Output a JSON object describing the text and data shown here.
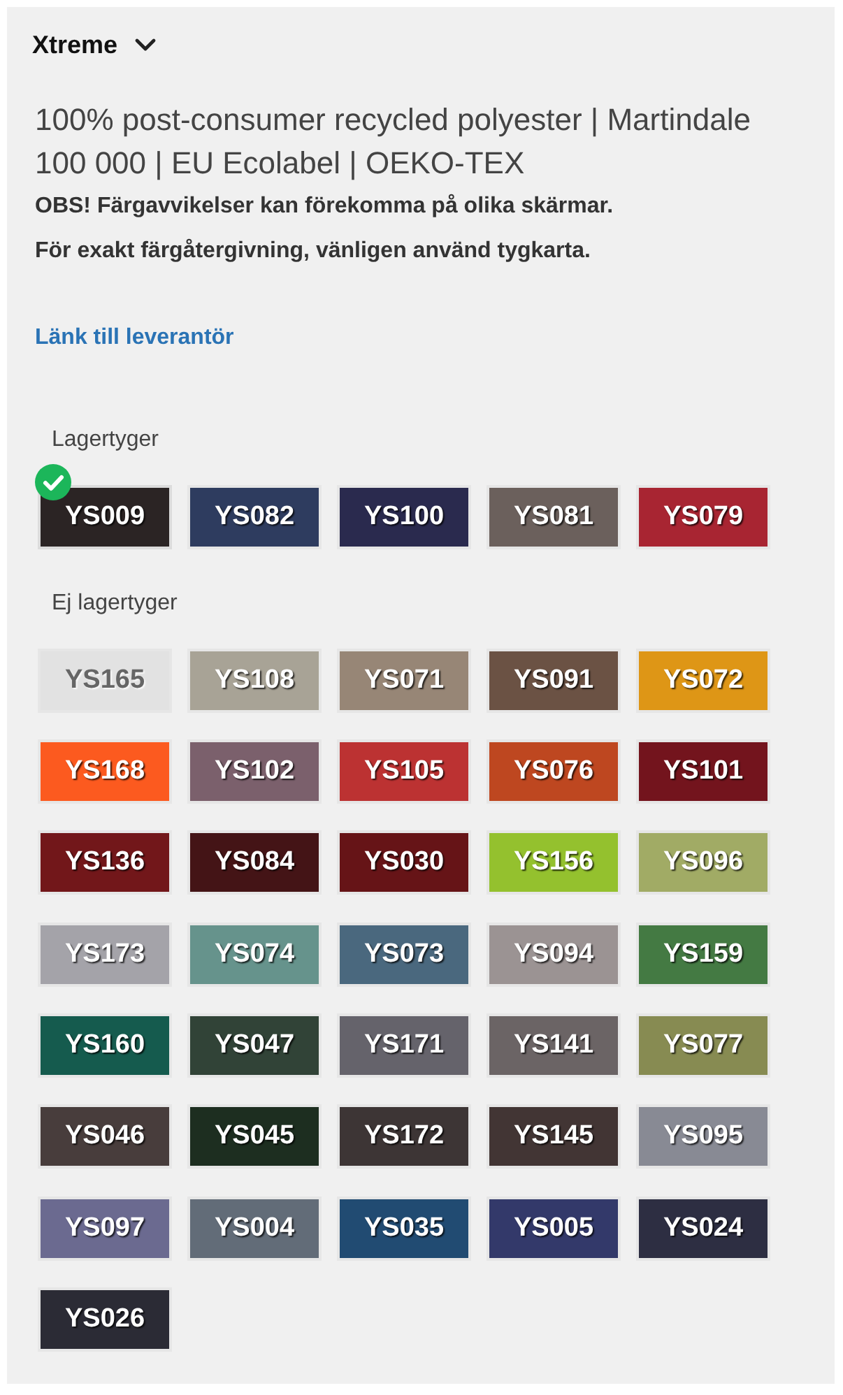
{
  "header": {
    "title": "Xtreme"
  },
  "description": "100% post-consumer recycled polyester | Martindale 100 000 | EU Ecolabel | OEKO-TEX",
  "notes": [
    "OBS! Färgavvikelser kan förekomma på olika skärmar.",
    "För exakt färgåtergivning, vänligen använd tygkarta."
  ],
  "supplier_link": "Länk till leverantör",
  "groups": [
    {
      "label": "Lagertyger",
      "swatches": [
        {
          "code": "YS009",
          "color": "#2b2424",
          "selected": true
        },
        {
          "code": "YS082",
          "color": "#2e3c5f",
          "selected": false
        },
        {
          "code": "YS100",
          "color": "#2a2a4e",
          "selected": false
        },
        {
          "code": "YS081",
          "color": "#6b605c",
          "selected": false
        },
        {
          "code": "YS079",
          "color": "#a82532",
          "selected": false
        }
      ]
    },
    {
      "label": "Ej lagertyger",
      "swatches": [
        {
          "code": "YS165",
          "color": "#e2e2e2",
          "selected": false
        },
        {
          "code": "YS108",
          "color": "#a8a396",
          "selected": false
        },
        {
          "code": "YS071",
          "color": "#978676",
          "selected": false
        },
        {
          "code": "YS091",
          "color": "#6b5244",
          "selected": false
        },
        {
          "code": "YS072",
          "color": "#de9616",
          "selected": false
        },
        {
          "code": "YS168",
          "color": "#fc5a1f",
          "selected": false
        },
        {
          "code": "YS102",
          "color": "#7b606c",
          "selected": false
        },
        {
          "code": "YS105",
          "color": "#bc3232",
          "selected": false
        },
        {
          "code": "YS076",
          "color": "#be4720",
          "selected": false
        },
        {
          "code": "YS101",
          "color": "#73141d",
          "selected": false
        },
        {
          "code": "YS136",
          "color": "#72171a",
          "selected": false
        },
        {
          "code": "YS084",
          "color": "#441416",
          "selected": false
        },
        {
          "code": "YS030",
          "color": "#661417",
          "selected": false
        },
        {
          "code": "YS156",
          "color": "#94c12e",
          "selected": false
        },
        {
          "code": "YS096",
          "color": "#a1ab65",
          "selected": false
        },
        {
          "code": "YS173",
          "color": "#a4a3a9",
          "selected": false
        },
        {
          "code": "YS074",
          "color": "#66938c",
          "selected": false
        },
        {
          "code": "YS073",
          "color": "#4a687e",
          "selected": false
        },
        {
          "code": "YS094",
          "color": "#9b9393",
          "selected": false
        },
        {
          "code": "YS159",
          "color": "#447a43",
          "selected": false
        },
        {
          "code": "YS160",
          "color": "#155b4e",
          "selected": false
        },
        {
          "code": "YS047",
          "color": "#314337",
          "selected": false
        },
        {
          "code": "YS171",
          "color": "#65636b",
          "selected": false
        },
        {
          "code": "YS141",
          "color": "#6b6465",
          "selected": false
        },
        {
          "code": "YS077",
          "color": "#878b52",
          "selected": false
        },
        {
          "code": "YS046",
          "color": "#483d3c",
          "selected": false
        },
        {
          "code": "YS045",
          "color": "#1d2e20",
          "selected": false
        },
        {
          "code": "YS172",
          "color": "#3d3535",
          "selected": false
        },
        {
          "code": "YS145",
          "color": "#423534",
          "selected": false
        },
        {
          "code": "YS095",
          "color": "#888a94",
          "selected": false
        },
        {
          "code": "YS097",
          "color": "#6b6a90",
          "selected": false
        },
        {
          "code": "YS004",
          "color": "#626c78",
          "selected": false
        },
        {
          "code": "YS035",
          "color": "#214b72",
          "selected": false
        },
        {
          "code": "YS005",
          "color": "#33396a",
          "selected": false
        },
        {
          "code": "YS024",
          "color": "#2d2e42",
          "selected": false
        },
        {
          "code": "YS026",
          "color": "#2b2b35",
          "selected": false
        }
      ]
    }
  ]
}
